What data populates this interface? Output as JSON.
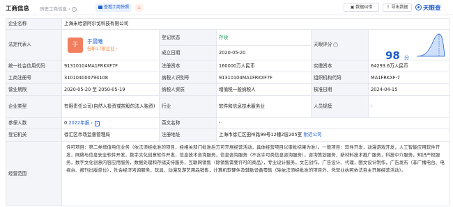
{
  "header": {
    "title": "工商信息",
    "history": "历史工商信息",
    "history_arrow": "›",
    "snapshot_button": "查看工商快照",
    "fire_icon": "fire-icon",
    "data_error_button": "数据纠错",
    "export_button": "导出数据",
    "logo_text": "天眼查"
  },
  "company_name": {
    "label": "企业名称",
    "value": "上海米哈游阿尔戈科技有限公司"
  },
  "legal_rep": {
    "label": "法定代表人",
    "avatar": "于",
    "name": "于晨曦",
    "sub": "任职17家企业",
    "sub_arrow": "›",
    "reg_status_label": "登记状态",
    "reg_status_value": "存续",
    "est_date_label": "成立日期",
    "est_date_value": "2020-05-20",
    "score_label": "天眼评分",
    "score_value": "98",
    "score_unit": "分",
    "accent": "#1f5fd0"
  },
  "rows": {
    "r1": {
      "l1": "统一社会信用代码",
      "v1": "91310104MA1FRKXF7F",
      "l2": "注册资本",
      "v2": "160000万人民币",
      "l3": "实缴资本",
      "v3": "64293.6万人民币"
    },
    "r2": {
      "l1": "工商注册号",
      "v1": "310104000794108",
      "l2": "纳税人识别号",
      "v2": "91310104MA1FRKXF7F",
      "l3": "组织机构代码",
      "v3": "MA1FRKXF-7"
    },
    "r3": {
      "l1": "营业期限",
      "v1": "2020-05-20 至 2050-05-19",
      "l2": "纳税人资质",
      "v2": "增值税一般纳税人",
      "l3": "核准日期",
      "v3": "2024-04-15"
    },
    "r4": {
      "l1": "企业类型",
      "v1": "有限责任公司(自然人投资或控股的法人独资)",
      "l2": "行业",
      "v2": "软件和信息技术服务业",
      "l3": "人员规模",
      "v3": "-"
    },
    "r5": {
      "l1": "参保人数",
      "v1a": "0",
      "v1b": "2022年报",
      "v1c": "›",
      "l2": "英文名称",
      "v2": "-"
    },
    "r6": {
      "l1": "登记机关",
      "v1": "徐汇区市场监督管理局",
      "l2": "注册地址",
      "v2": "上海市徐汇区田州路99号12幢2层205室",
      "v2link": "附近公司"
    },
    "r7": {
      "l1": "经营范围",
      "v1": "许可项目：第二类增值电信业务（依法须经批准的项目，经相关部门批准后方可开展经营活动，具体经营项目以审批结果为准）。一般项目：软件开发，动漫游戏开发，人工智能应用软件开发，网络与信息安全软件开发，数字文化创意软件开发，信息技术咨询服务，信息咨询服务（不含许可类信息咨询服务），咨询策划服务，新材料技术推广服务，科技中介服务，知识产权服务，数字文化创意内容应用服务，数据处理和存储支持服务，互联网销售（除销售需要许可的商品），专业设计服务，文艺创作，广告设计、代理，图文设计制作，广告发布（非广播电台、电视台、报刊出版单位），社会经济咨询服务，玩具、动漫及游艺用品销售，计算机软硬件及辅助设备零售（除依法须经批准的项目外，凭营业执照依法自主开展经营活动）。"
    }
  }
}
